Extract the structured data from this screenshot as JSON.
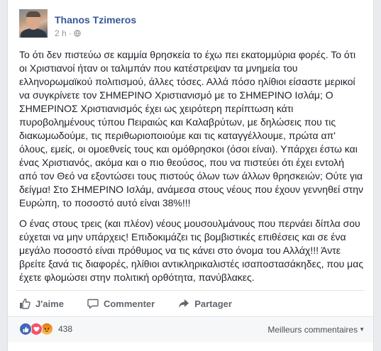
{
  "post": {
    "author": "Thanos Tzimeros",
    "time": "2 h",
    "dot": "·",
    "paragraphs": [
      "Το ότι δεν πιστεύω σε καμμία θρησκεία το έχω πει εκατομμύρια φορές. Το ότι οι Χριστιανοί ήταν οι ταλιμπάν που κατέστρεψαν τα μνημεία του ελληνορωμαϊκού πολιτισμού, άλλες τόσες. Αλλά πόσο ηλίθιοι είσαστε μερικοί να συγκρίνετε τον ΣΗΜΕΡΙΝΟ Χριστιανισμό με το ΣΗΜΕΡΙΝΟ Ισλάμ; Ο ΣΗΜΕΡΙΝΟΣ Χριστιανισμός έχει ως χειρότερη περίπτωση κάτι πυροβολημένους τύπου Πειραιώς και Καλαβρύτων, με δηλώσεις που τις διακωμωδούμε, τις περιθωριοποιούμε και τις καταγγέλλουμε, πρώτα απ' όλους, εμείς, οι ομοεθνείς τους και ομόθρησκοι (όσοι είναι). Υπάρχει έστω και ένας Χριστιανός, ακόμα και ο πιο θεούσος, που να πιστεύει ότι έχει εντολή από τον Θεό να εξοντώσει τους πιστούς όλων των άλλων θρησκειών; Ούτε για δείγμα! Στο ΣΗΜΕΡΙΝΟ Ισλάμ, ανάμεσα στους νέους που έχουν γεννηθεί στην Ευρώπη, το ποσοστό αυτό είναι 38%!!!",
      "Ο ένας στους τρεις (και πλέον) νέους μουσουλμάνους που περνάει δίπλα σου εύχεται να μην υπάρχεις! Επιδοκιμάζει τις βομβιστικές επιθέσεις και σε ένα μεγάλο ποσοστό είναι πρόθυμος να τις κάνει στο όνομα του Αλλάχ!!! Άντε βρείτε ξανά τις διαφορές, ηλίθιοι αντικληρικαλιστές ισαποστασάκηδες, που μας έχετε φλομώσει στην πολιτική ορθότητα, πανύβλακες."
    ]
  },
  "actions": {
    "like_label": "J'aime",
    "comment_label": "Commenter",
    "share_label": "Partager"
  },
  "reactions": {
    "types": [
      "like",
      "love",
      "angry"
    ],
    "count": "438",
    "sort_label": "Meilleurs commentaires"
  },
  "colors": {
    "link": "#365899",
    "meta": "#90949c",
    "action": "#616770",
    "like": "#4267b2",
    "love": "#f25268",
    "angry": "#e9710f"
  }
}
